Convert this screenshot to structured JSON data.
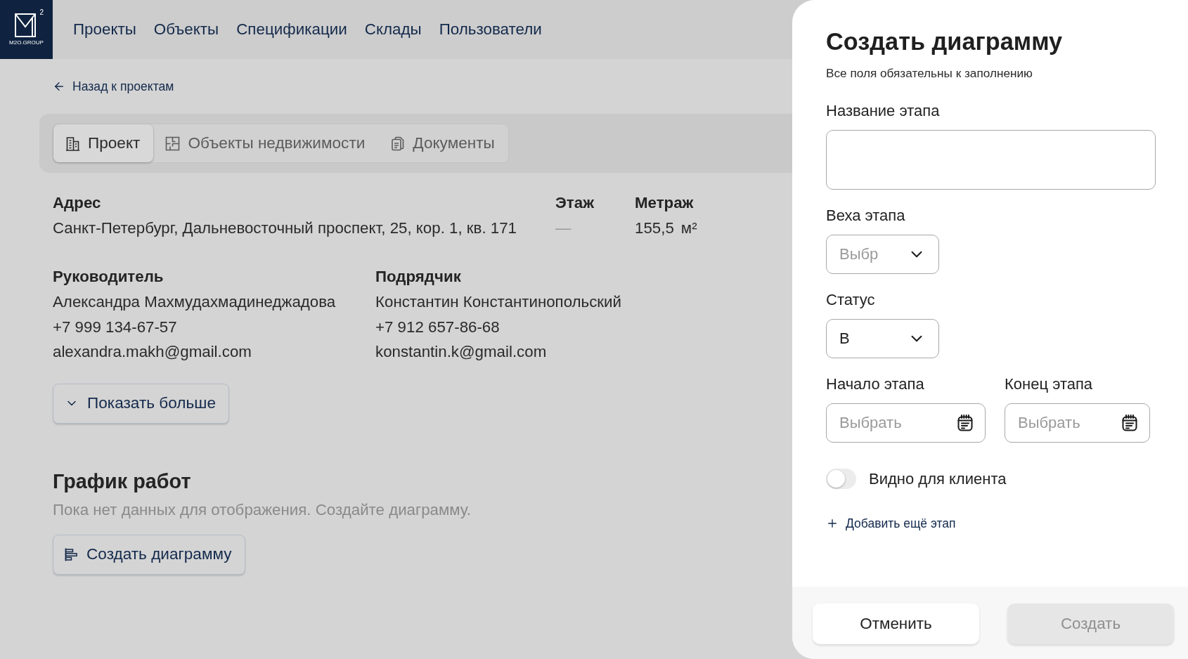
{
  "logo": {
    "superscript": "2",
    "caption": "M2O.GROUP"
  },
  "nav": [
    {
      "label": "Проекты"
    },
    {
      "label": "Объекты"
    },
    {
      "label": "Спецификации"
    },
    {
      "label": "Склады"
    },
    {
      "label": "Пользователи"
    }
  ],
  "back_link": {
    "label": "Назад к проектам"
  },
  "tabs": [
    {
      "label": "Проект",
      "selected": true
    },
    {
      "label": "Объекты недвижимости",
      "selected": false
    },
    {
      "label": "Документы",
      "selected": false
    }
  ],
  "details": [
    {
      "label": "Адрес",
      "value": "Санкт-Петербург, Дальневосточный проспект, 25, кор. 1, кв. 171",
      "muted": false
    },
    {
      "label": "Этаж",
      "value": "—",
      "muted": true
    },
    {
      "label": "Метраж",
      "value": "155,5",
      "unit": "м²",
      "muted": false
    }
  ],
  "contacts": [
    {
      "role": "Руководитель",
      "name": "Александра Махмудахмадинеджадова",
      "phone": "+7 999 134-67-57",
      "email": "alexandra.makh@gmail.com"
    },
    {
      "role": "Подрядчик",
      "name": "Константин Константинопольский",
      "phone": "+7 912 657-86-68",
      "email": "konstantin.k@gmail.com"
    }
  ],
  "show_more_button": {
    "label": "Показать больше"
  },
  "schedule": {
    "title": "График работ",
    "empty_text": "Пока нет данных для отображения. Создайте диаграмму.",
    "create_button": {
      "label": "Создать диаграмму"
    }
  },
  "dialog": {
    "title": "Создать диаграмму",
    "subtitle": "Все поля обязательны к заполнению",
    "fields": [
      {
        "kind": "text",
        "label": "Название этапа"
      },
      {
        "kind": "select",
        "label": "Веха этапа",
        "placeholder": "Выбр"
      },
      {
        "kind": "select",
        "label": "Статус",
        "value": "В"
      }
    ],
    "dates": [
      {
        "label": "Начало этапа",
        "placeholder": "Выбрать"
      },
      {
        "label": "Конец этапа",
        "placeholder": "Выбрать"
      }
    ],
    "visible_to_client": {
      "label": "Видно для клиента",
      "on": false
    },
    "add_stage_link": {
      "label": "Добавить ещё этап"
    },
    "actions": [
      {
        "label": "Отменить",
        "kind": "secondary",
        "disabled": false
      },
      {
        "label": "Создать",
        "kind": "primary",
        "disabled": true
      }
    ]
  }
}
